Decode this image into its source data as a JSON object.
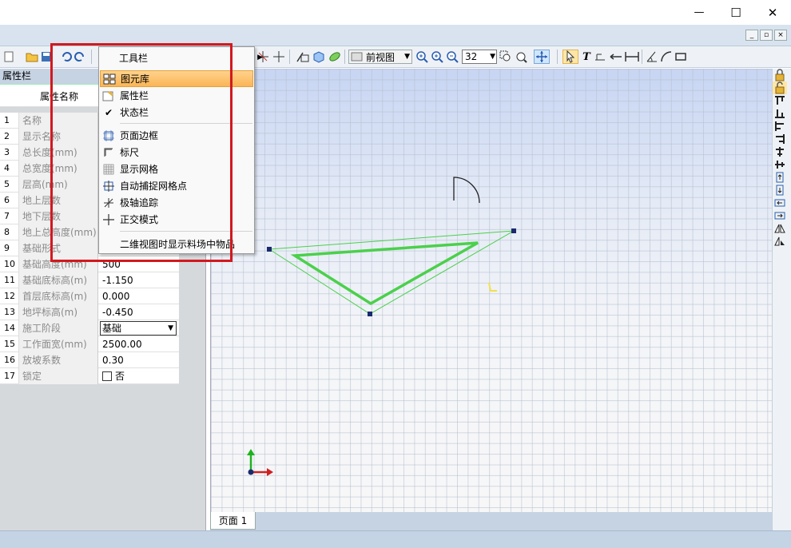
{
  "window": {
    "minimize_glyph": "—",
    "maximize_glyph": "☐",
    "close_glyph": "✕"
  },
  "toolbar": {
    "view_select": "前视图",
    "zoom_value": "32",
    "toolbar_menu_label": "工具栏"
  },
  "property_panel": {
    "title": "属性栏",
    "header_name": "属性名称",
    "rows": [
      {
        "num": "1",
        "name": "名称",
        "value": ""
      },
      {
        "num": "2",
        "name": "显示名称",
        "value": ""
      },
      {
        "num": "3",
        "name": "总长度(mm)",
        "value": ""
      },
      {
        "num": "4",
        "name": "总宽度(mm)",
        "value": ""
      },
      {
        "num": "5",
        "name": "层高(mm)",
        "value": ""
      },
      {
        "num": "6",
        "name": "地上层数",
        "value": ""
      },
      {
        "num": "7",
        "name": "地下层数",
        "value": ""
      },
      {
        "num": "8",
        "name": "地上总高度(mm)",
        "value": ""
      },
      {
        "num": "9",
        "name": "基础形式",
        "value": ""
      },
      {
        "num": "10",
        "name": "基础高度(mm)",
        "value": "500"
      },
      {
        "num": "11",
        "name": "基础底标高(m)",
        "value": "-1.150"
      },
      {
        "num": "12",
        "name": "首层底标高(m)",
        "value": "0.000"
      },
      {
        "num": "13",
        "name": "地坪标高(m)",
        "value": "-0.450"
      },
      {
        "num": "14",
        "name": "施工阶段",
        "value": "基础"
      },
      {
        "num": "15",
        "name": "工作面宽(mm)",
        "value": "2500.00"
      },
      {
        "num": "16",
        "name": "放坡系数",
        "value": "0.30"
      },
      {
        "num": "17",
        "name": "锁定",
        "value": "否"
      }
    ]
  },
  "menu": {
    "items": [
      {
        "label": "图元库",
        "icon": "library-icon",
        "highlighted": true
      },
      {
        "label": "属性栏",
        "icon": "property-icon"
      },
      {
        "label": "状态栏",
        "icon": "check-icon",
        "checked": true
      },
      {
        "label": "页面边框",
        "icon": "page-border-icon"
      },
      {
        "label": "标尺",
        "icon": "ruler-icon"
      },
      {
        "label": "显示网格",
        "icon": "grid-icon"
      },
      {
        "label": "自动捕捉网格点",
        "icon": "snap-grid-icon"
      },
      {
        "label": "极轴追踪",
        "icon": "polar-track-icon"
      },
      {
        "label": "正交模式",
        "icon": "ortho-icon"
      },
      {
        "label": "二维视图时显示料场中物品",
        "icon": ""
      }
    ]
  },
  "page_tabs": [
    {
      "label": "页面 1"
    }
  ],
  "colors": {
    "accent_red": "#d2191f",
    "shape_green": "#4bd04b",
    "menu_highlight": "#fbb556"
  }
}
